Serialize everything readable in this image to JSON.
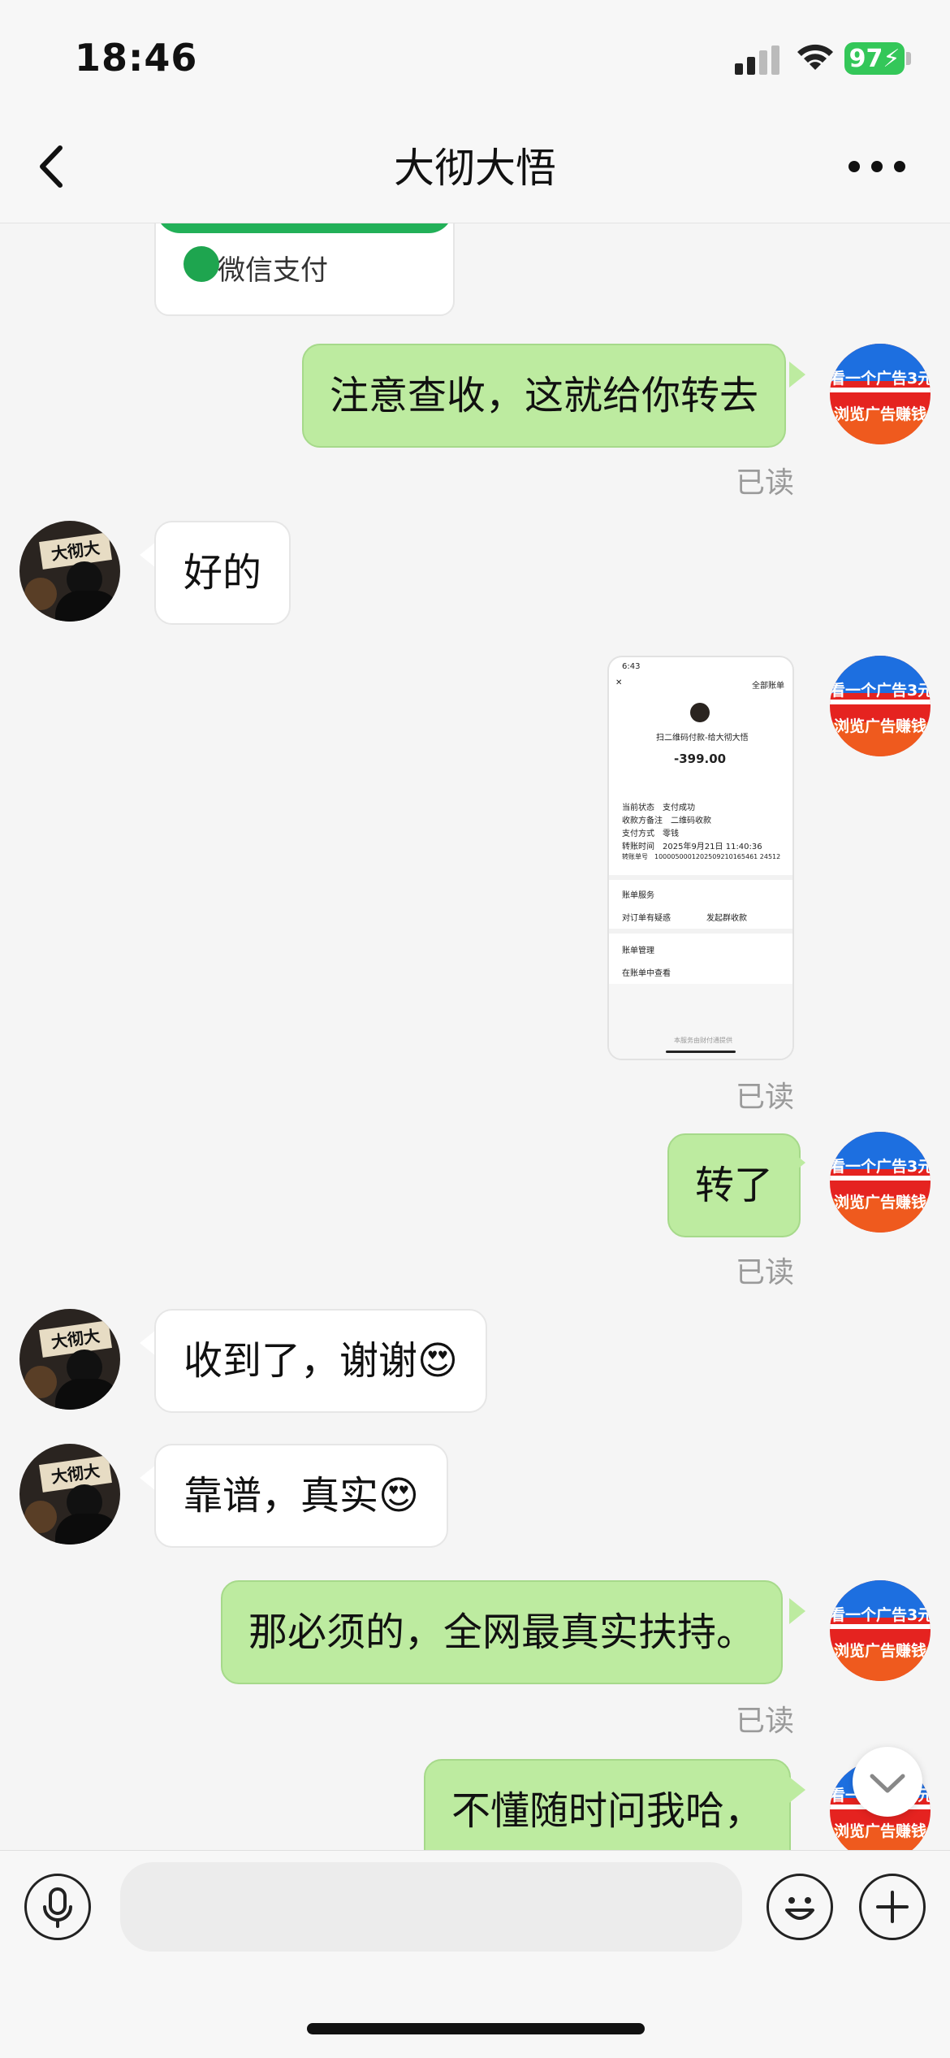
{
  "status_bar": {
    "time": "18:46",
    "battery": "97"
  },
  "nav": {
    "title": "大彻大悟",
    "back_icon": "chevron-left-icon",
    "more_icon": "more-dots-icon"
  },
  "pay_card": {
    "label": "微信支付"
  },
  "my_avatar": {
    "line1": "看一个广告3元",
    "line2": "浏览广告赚钱"
  },
  "contact_avatar": {
    "sign_text": "大彻大"
  },
  "messages": [
    {
      "from": "me",
      "text": "注意查收，这就给你转去",
      "status": "已读"
    },
    {
      "from": "them",
      "text": "好的"
    },
    {
      "from": "me",
      "type": "image",
      "status": "已读"
    },
    {
      "from": "me",
      "text": "转了",
      "status": "已读"
    },
    {
      "from": "them",
      "text": "收到了，谢谢😍"
    },
    {
      "from": "them",
      "text": "靠谱，真实😍"
    },
    {
      "from": "me",
      "text": "那必须的，全网最真实扶持。",
      "status": "已读"
    },
    {
      "from": "me",
      "text": "不懂随时问我哈，"
    }
  ],
  "receipt": {
    "time": "6:43",
    "header": "全部账单",
    "merchant": "扫二维码付款-给大彻大悟",
    "amount": "-399.00",
    "rows": [
      {
        "k": "当前状态",
        "v": "支付成功"
      },
      {
        "k": "收款方备注",
        "v": "二维码收款"
      },
      {
        "k": "支付方式",
        "v": "零钱"
      },
      {
        "k": "转账时间",
        "v": "2025年9月21日 11:40:36"
      },
      {
        "k": "转账单号",
        "v": "1000050001202509210165461 24512"
      }
    ],
    "section1": "账单服务",
    "link1": "对订单有疑惑",
    "link2": "发起群收款",
    "section2": "账单管理",
    "link3": "在账单中查看",
    "footer": "本服务由财付通提供"
  },
  "colors": {
    "bubble_out": "#bdeba0",
    "bubble_in": "#ffffff",
    "accent_green": "#22b058"
  }
}
